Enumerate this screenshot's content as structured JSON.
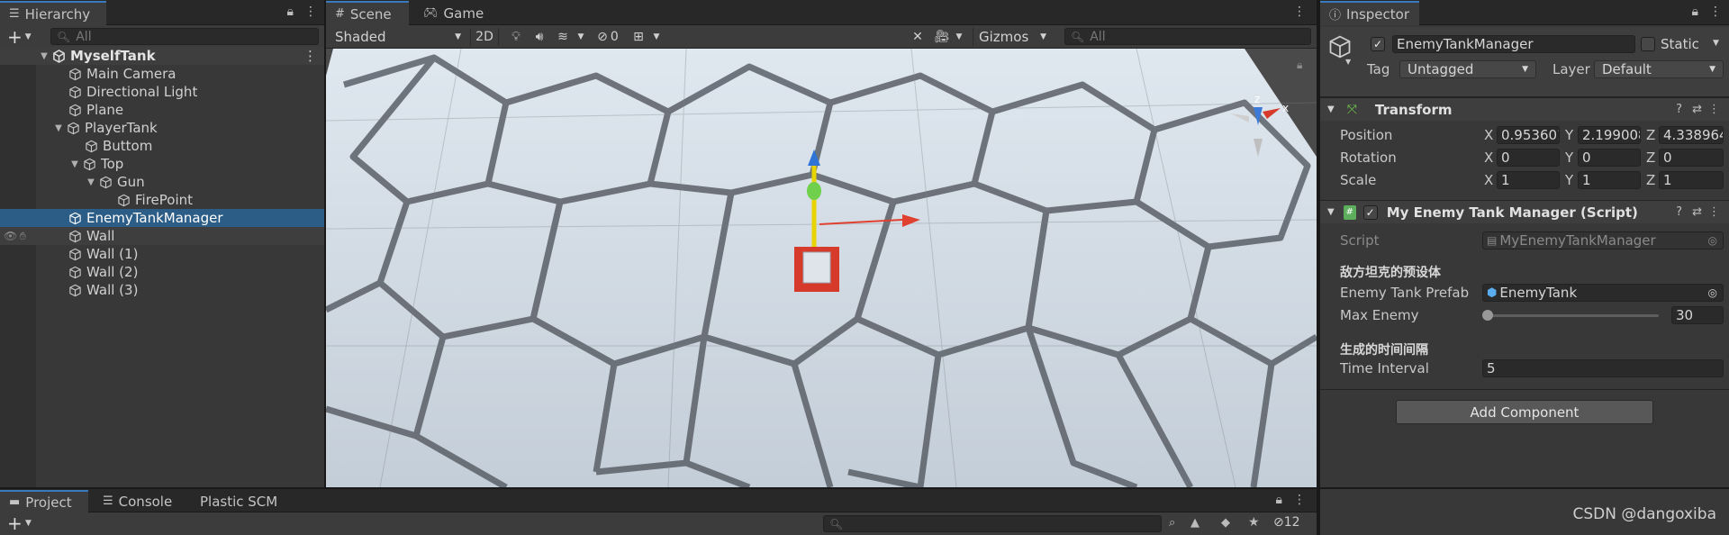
{
  "hierarchy": {
    "tab_label": "Hierarchy",
    "search_placeholder": "All",
    "root": "MyselfTank",
    "items": [
      "Main Camera",
      "Directional Light",
      "Plane",
      "PlayerTank",
      "Buttom",
      "Top",
      "Gun",
      "FirePoint",
      "EnemyTankManager",
      "Wall",
      "Wall (1)",
      "Wall (2)",
      "Wall (3)"
    ]
  },
  "scene": {
    "tabs": [
      "Scene",
      "Game"
    ],
    "shading": "Shaded",
    "mode_2d": "2D",
    "hidden_count": "0",
    "gizmos": "Gizmos",
    "search_placeholder": "All",
    "axis_z": "z",
    "axis_x": "x"
  },
  "inspector": {
    "tab_label": "Inspector",
    "object_name": "EnemyTankManager",
    "static_label": "Static",
    "tag_label": "Tag",
    "tag_value": "Untagged",
    "layer_label": "Layer",
    "layer_value": "Default",
    "transform": {
      "title": "Transform",
      "position_label": "Position",
      "rotation_label": "Rotation",
      "scale_label": "Scale",
      "axis_x": "X",
      "axis_y": "Y",
      "axis_z": "Z",
      "position": [
        "0.953601",
        "2.199008",
        "4.338964"
      ],
      "rotation": [
        "0",
        "0",
        "0"
      ],
      "scale": [
        "1",
        "1",
        "1"
      ]
    },
    "script_component": {
      "title": "My Enemy Tank Manager (Script)",
      "script_label": "Script",
      "script_value": "MyEnemyTankManager",
      "header1": "敌方坦克的预设体",
      "prefab_label": "Enemy Tank Prefab",
      "prefab_value": "EnemyTank",
      "max_enemy_label": "Max Enemy",
      "max_enemy_value": "30",
      "max_enemy_fraction": 0.0,
      "header2": "生成的时间间隔",
      "interval_label": "Time Interval",
      "interval_value": "5"
    },
    "add_component": "Add Component"
  },
  "bottom": {
    "tabs": [
      "Project",
      "Console",
      "Plastic SCM"
    ],
    "hidden_count": "12",
    "watermark": "CSDN @dangoxiba"
  }
}
